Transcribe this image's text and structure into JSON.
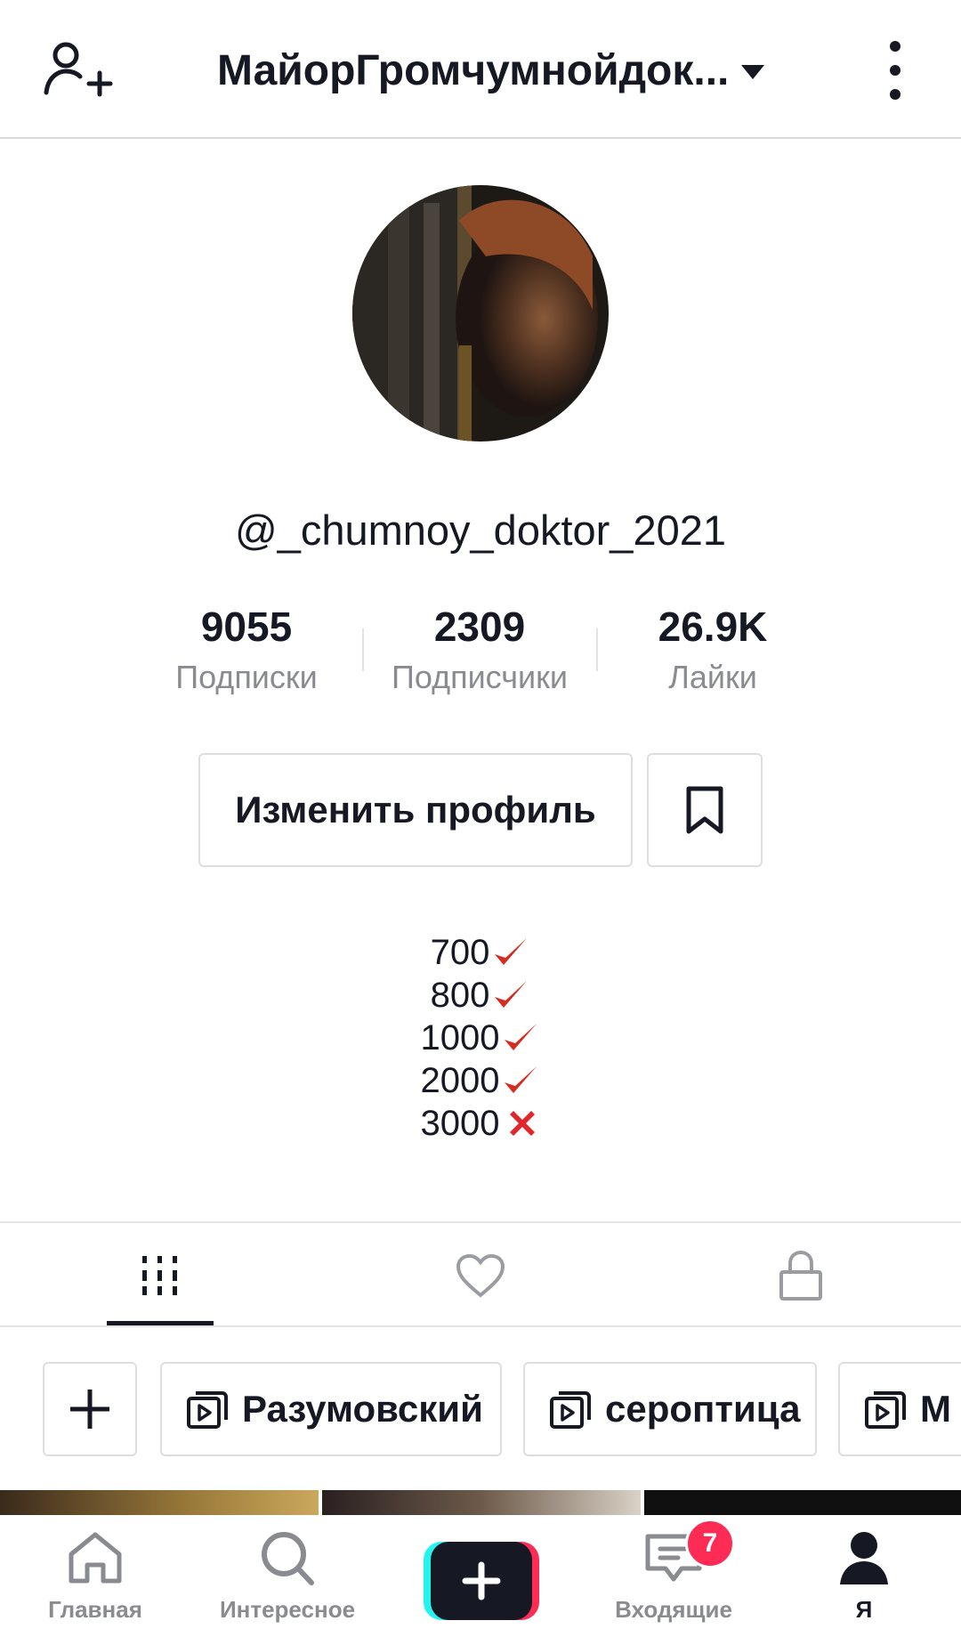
{
  "header": {
    "title": "МайорГромчумнойдок...",
    "icons": [
      "add-user-icon",
      "caret-down-icon",
      "more-vertical-icon"
    ]
  },
  "profile": {
    "username": "@_chumnoy_doktor_2021",
    "stats": [
      {
        "value": "9055",
        "label": "Подписки"
      },
      {
        "value": "2309",
        "label": "Подписчики"
      },
      {
        "value": "26.9K",
        "label": "Лайки"
      }
    ],
    "edit_label": "Изменить профиль",
    "bio_lines": [
      {
        "text": "700",
        "mark": "check"
      },
      {
        "text": "800",
        "mark": "check"
      },
      {
        "text": "1000",
        "mark": "check"
      },
      {
        "text": "2000",
        "mark": "check"
      },
      {
        "text": "3000",
        "mark": "cross"
      }
    ]
  },
  "tabs": [
    {
      "name": "videos",
      "icon": "grid-icon",
      "active": true
    },
    {
      "name": "liked",
      "icon": "heart-icon",
      "active": false
    },
    {
      "name": "private",
      "icon": "lock-icon",
      "active": false
    }
  ],
  "playlists": [
    {
      "label": "Разумовский"
    },
    {
      "label": "сероптица"
    },
    {
      "label": "М"
    }
  ],
  "bottom_nav": [
    {
      "label": "Главная",
      "icon": "home-icon"
    },
    {
      "label": "Интересное",
      "icon": "search-icon"
    },
    {
      "label": "",
      "icon": "create-plus-icon"
    },
    {
      "label": "Входящие",
      "icon": "inbox-icon"
    },
    {
      "label": "Я",
      "icon": "profile-icon"
    }
  ],
  "inbox_badge": "7",
  "colors": {
    "text": "#161823",
    "secondary": "#8a8b91",
    "accent": "#fe2c55",
    "cyan": "#25f4ee",
    "check": "#d62b1f"
  }
}
